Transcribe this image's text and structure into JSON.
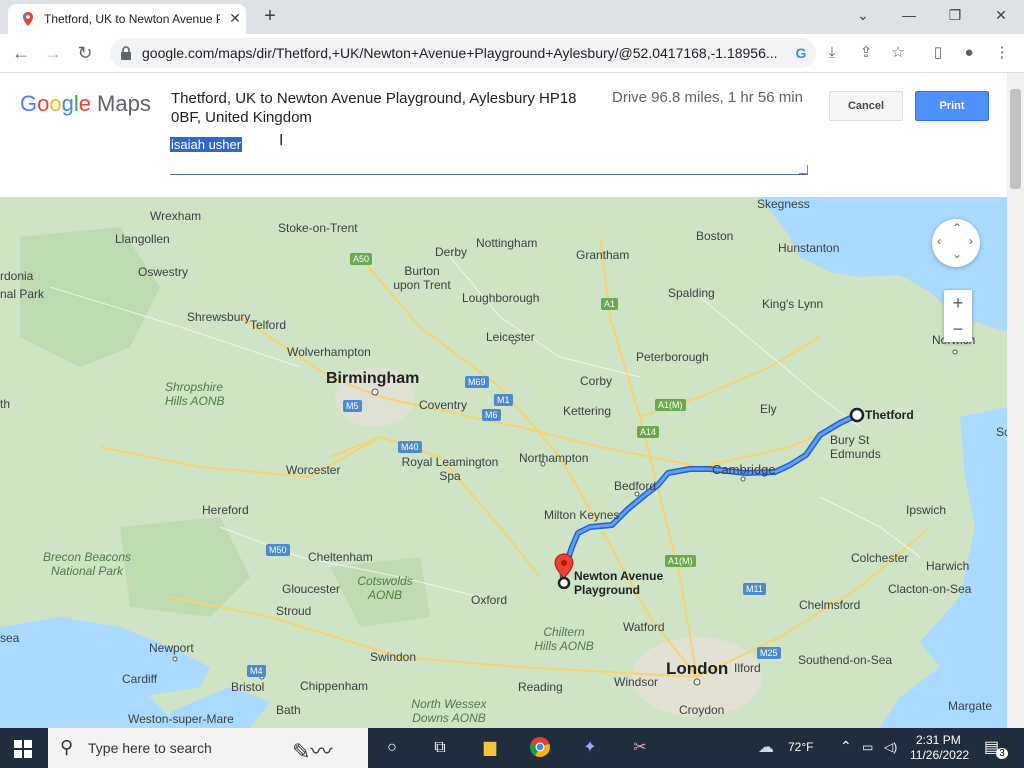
{
  "browser": {
    "tab_title": "Thetford, UK to Newton Avenue Pla",
    "tab_close": "✕",
    "new_tab": "+",
    "url": "google.com/maps/dir/Thetford,+UK/Newton+Avenue+Playground+Aylesbury/@52.0417168,-1.18956..."
  },
  "header": {
    "logo_google": "Google",
    "logo_maps": "Maps",
    "route_title": "Thetford, UK to Newton Avenue Playground, Aylesbury HP18 0BF, United Kingdom",
    "drive_info": "Drive 96.8 miles, 1 hr 56 min",
    "cancel_label": "Cancel",
    "print_label": "Print",
    "notes_value": "isaiah usher"
  },
  "map": {
    "labels": [
      "Skegness",
      "Wrexham",
      "Stoke-on-Trent",
      "Nottingham",
      "Boston",
      "Hunstanton",
      "Llangollen",
      "Derby",
      "Grantham",
      "Oswestry",
      "Burton upon Trent",
      "Loughborough",
      "Spalding",
      "King's Lynn",
      "Shrewsbury",
      "Telford",
      "Leicester",
      "Norwich",
      "Wolverhampton",
      "Peterborough",
      "Birmingham",
      "Corby",
      "Coventry",
      "Kettering",
      "Ely",
      "Thetford",
      "Bury St Edmunds",
      "Worcester",
      "Royal Leamington Spa",
      "Northampton",
      "Cambridge",
      "Bedford",
      "Hereford",
      "Milton Keynes",
      "Ipswich",
      "Cheltenham",
      "Gloucester",
      "Stroud",
      "Oxford",
      "Colchester",
      "Harwich",
      "Clacton-on-Sea",
      "Chelmsford",
      "Newport",
      "Watford",
      "Swindon",
      "Cardiff",
      "Bristol",
      "Chippenham",
      "Southend-on-Sea",
      "Reading",
      "Windsor",
      "Ilford",
      "London",
      "Croydon",
      "Margate",
      "Bath",
      "Weston-super-Mare"
    ],
    "parks": [
      "Shropshire Hills AONB",
      "Brecon Beacons National Park",
      "Cotswolds AONB",
      "Chiltern Hills AONB",
      "North Wessex Downs AONB"
    ],
    "destination": "Newton Avenue Playground",
    "origin": "Thetford",
    "zoom_in": "+",
    "zoom_out": "−",
    "roads": [
      "A50",
      "A1",
      "M69",
      "M1",
      "M6",
      "A1(M)",
      "A14",
      "M5",
      "M40",
      "M50",
      "M11",
      "M25",
      "M4",
      "A1(M)"
    ],
    "edge_labels": [
      "rdonia",
      "nal Park",
      "sea",
      "So",
      "th"
    ]
  },
  "taskbar": {
    "search_placeholder": "Type here to search",
    "weather": "72°F",
    "time": "2:31 PM",
    "date": "11/26/2022",
    "notifications": "3"
  }
}
